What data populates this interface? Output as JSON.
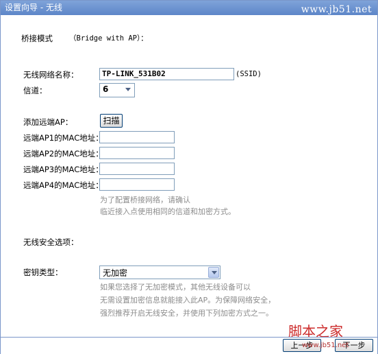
{
  "window": {
    "title": "设置向导 - 无线",
    "watermark": "www.jb51.net"
  },
  "bridge": {
    "mode_label": "桥接模式",
    "mode_en": "（Bridge with AP）："
  },
  "wireless": {
    "ssid_label": "无线网络名称：",
    "ssid_value": "TP-LINK_531B02",
    "ssid_suffix": "(SSID)",
    "channel_label": "信道：",
    "channel_value": "6"
  },
  "remote": {
    "add_label": "添加远端AP：",
    "scan_button": "扫描",
    "mac1_label": "远端AP1的MAC地址：",
    "mac2_label": "远端AP2的MAC地址：",
    "mac3_label": "远端AP3的MAC地址：",
    "mac4_label": "远端AP4的MAC地址：",
    "hint_line1": "为了配置桥接网络，请确认",
    "hint_line2": "临近接入点使用相同的信道和加密方式。"
  },
  "security": {
    "section_label": "无线安全选项：",
    "key_type_label": "密钥类型：",
    "key_type_value": "无加密",
    "hint_line1": "如果您选择了无加密模式，其他无线设备可以",
    "hint_line2": "无需设置加密信息就能接入此AP。为保障网络安全，",
    "hint_line3": "强烈推荐开启无线安全，并使用下列加密方式之一。"
  },
  "footer": {
    "prev_button": "上一步",
    "next_button": "下一步",
    "watermark_cn": "脚本之家",
    "watermark_url": "www.jb51.net"
  }
}
